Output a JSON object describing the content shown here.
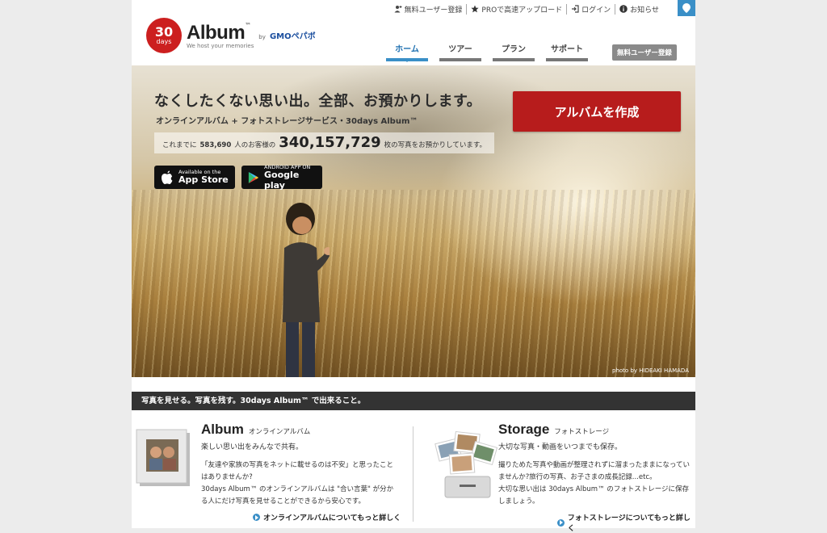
{
  "util_nav": {
    "signup": "無料ユーザー登録",
    "pro": "PROで高速アップロード",
    "login": "ログイン",
    "news": "お知らせ"
  },
  "logo": {
    "number": "30",
    "days": "days",
    "word": "Album",
    "tm": "™",
    "by": "by",
    "gmo": "GMOペパボ",
    "tagline": "We host your memories"
  },
  "nav": {
    "tabs": [
      {
        "label": "ホーム",
        "active": true
      },
      {
        "label": "ツアー",
        "active": false
      },
      {
        "label": "プラン",
        "active": false
      },
      {
        "label": "サポート",
        "active": false
      }
    ],
    "signup_button": "無料ユーザー登録"
  },
  "hero": {
    "headline": "なくしたくない思い出。全部、お預かりします。",
    "subline": "オンラインアルバム + フォトストレージサービス・30days Album™",
    "stats": {
      "prefix": "これまでに",
      "users": "583,690",
      "middle": "人のお客様の",
      "photos": "340,157,729",
      "suffix": "枚の写真をお預かりしています。"
    },
    "app_store": {
      "small": "Available on the",
      "big": "App Store"
    },
    "google_play": {
      "small": "ANDROID APP ON",
      "big": "Google play"
    },
    "create_button": "アルバムを作成",
    "credit": "photo by HIDEAKI HAMADA"
  },
  "features": {
    "bar": "写真を見せる。写真を残す。30days Album™ で出来ること。",
    "album": {
      "title": "Album",
      "kana": "オンラインアルバム",
      "lead": "楽しい思い出をみんなで共有。",
      "body": "「友達や家族の写真をネットに載せるのは不安」と思ったことはありませんか?\n30days Album™ のオンラインアルバムは \"合い言葉\" が分かる人にだけ写真を見せることができるから安心です。",
      "more": "オンラインアルバムについてもっと詳しく"
    },
    "storage": {
      "title": "Storage",
      "kana": "フォトストレージ",
      "lead": "大切な写真・動画をいつまでも保存。",
      "body": "撮りためた写真や動画が整理されずに溜まったままになっていませんか?旅行の写真、お子さまの成長記録...etc。\n大切な思い出は 30days Album™ のフォトストレージに保存しましょう。",
      "more": "フォトストレージについてもっと詳しく"
    }
  },
  "colors": {
    "accent_red": "#b71c1c",
    "nav_blue": "#3a8fc7",
    "dark_bar": "#333333"
  }
}
